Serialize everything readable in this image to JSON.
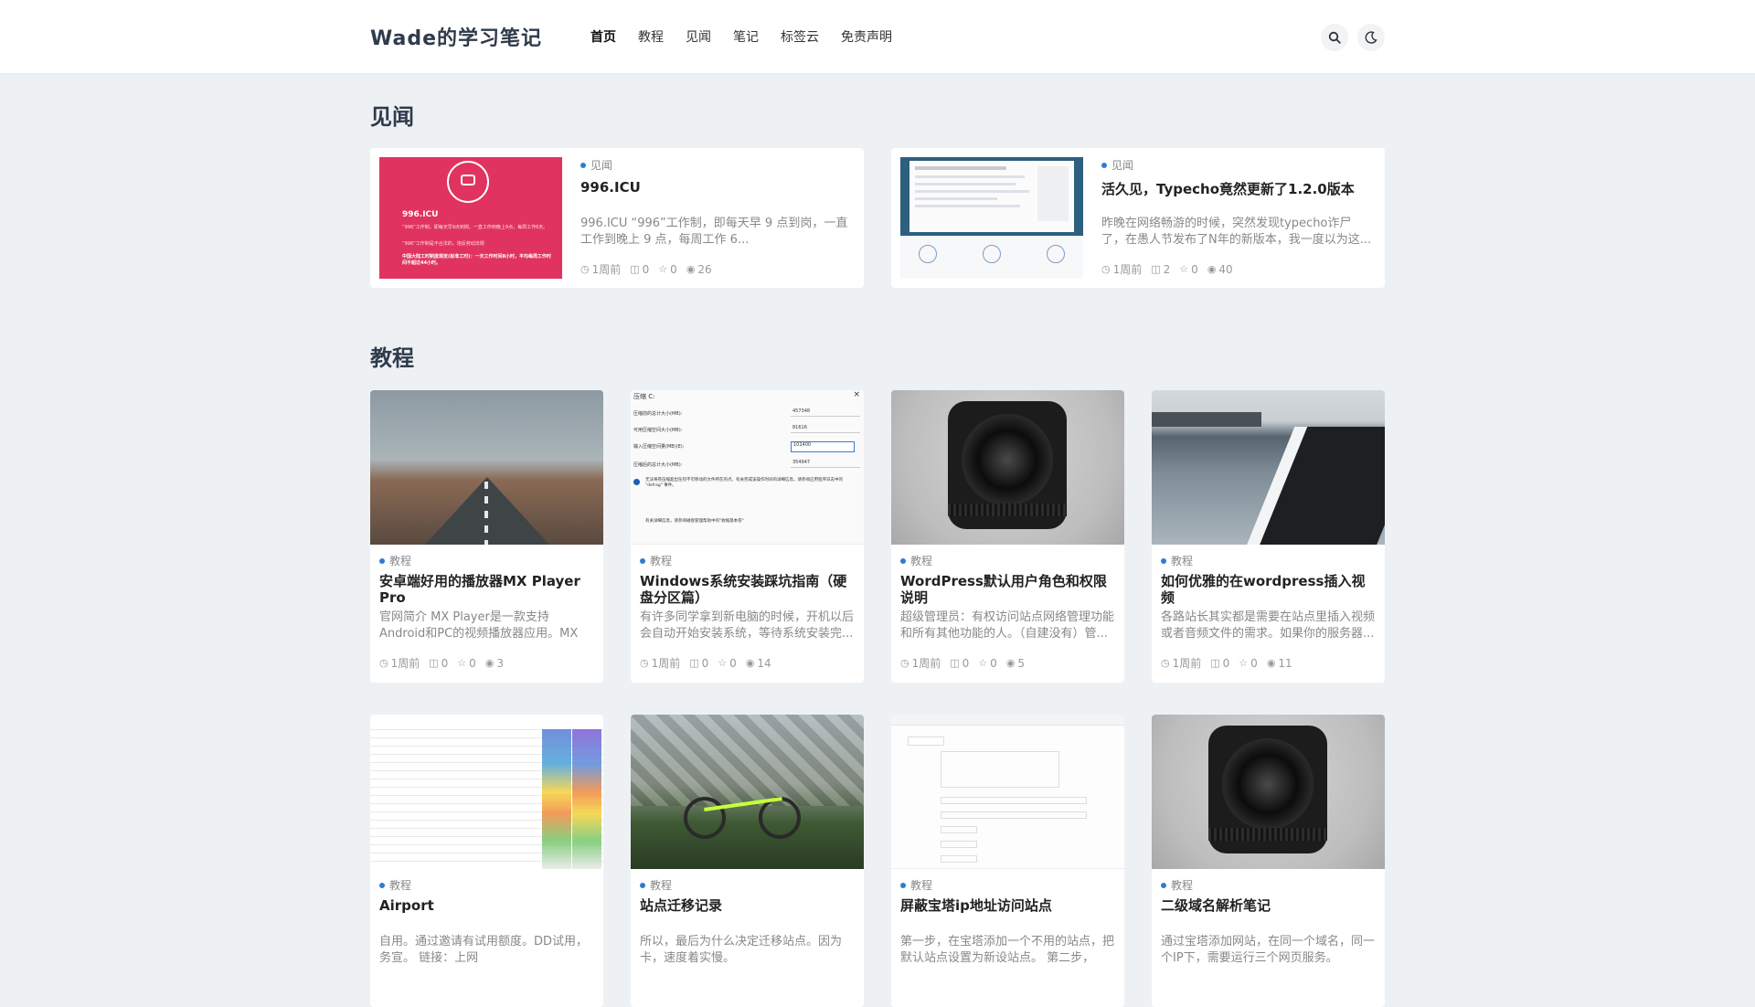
{
  "site": {
    "brand": "Wade的学习笔记"
  },
  "nav": [
    "首页",
    "教程",
    "见闻",
    "笔记",
    "标签云",
    "免责声明"
  ],
  "tools": {
    "search_icon": "⌕",
    "theme_icon": "☾"
  },
  "sections": {
    "news_title": "见闻",
    "tutorial_title": "教程"
  },
  "news": [
    {
      "category": "见闻",
      "title": "996.ICU",
      "excerpt": "996.ICU “996”工作制，即每天早 9 点到岗，一直工作到晚上 9 点，每周工作 6...",
      "time": "1周前",
      "comments": "0",
      "likes": "0",
      "views": "26",
      "thumb": {
        "heading": "996.ICU",
        "lines": [
          "“996”工作制，即每天早9点到岗，一直工作到晚上9点，每周工作6天。",
          "“996”工作制是不合法的，违反劳动法规",
          "中国大陆工时制度规定(标准工时)：一天工作时间8小时，平均每周工作时间不超过44小时。"
        ]
      }
    },
    {
      "category": "见闻",
      "title": "活久见，Typecho竟然更新了1.2.0版本",
      "excerpt": "昨晚在网络畅游的时候，突然发现typecho诈尸了，在愚人节发布了N年的新版本，我一度以为这...",
      "time": "1周前",
      "comments": "2",
      "likes": "0",
      "views": "40"
    }
  ],
  "tutorials": [
    {
      "category": "教程",
      "title": "安卓端好用的播放器MX Player Pro",
      "excerpt": "官网简介 MX Player是一款支持Android和PC的视频播放器应用。MX Playe...",
      "time": "1周前",
      "comments": "0",
      "likes": "0",
      "views": "3"
    },
    {
      "category": "教程",
      "title": "Windows系统安装踩坑指南（硬盘分区篇）",
      "excerpt": "有许多同学拿到新电脑的时候，开机以后会自动开始安装系统，等待系统安装完...",
      "time": "1周前",
      "comments": "0",
      "likes": "0",
      "views": "14",
      "thumb": {
        "header": "压缩 C:",
        "rows": [
          [
            "压缩前的总计大小(MB):",
            "457348"
          ],
          [
            "可用压缩空间大小(MB):",
            "81616"
          ],
          [
            "输入压缩空间量(MB)(E):",
            "102400"
          ],
          [
            "压缩后的总计大小(MB):",
            "354947"
          ]
        ],
        "note": "无法将卷压缩超出任何不可移动的文件所在的点。有关完成该操作时间的详细信息，请参阅应用程序日志中的 \"defrag\" 事件。",
        "note2": "有关详细信息，请参阅磁盘管理帮助中的\"收缩基本卷\""
      }
    },
    {
      "category": "教程",
      "title": "WordPress默认用户角色和权限说明",
      "excerpt": "超级管理员：有权访问站点网络管理功能和所有其他功能的人。（自建没有）管...",
      "time": "1周前",
      "comments": "0",
      "likes": "0",
      "views": "5"
    },
    {
      "category": "教程",
      "title": "如何优雅的在wordpress插入视频",
      "excerpt": "各路站长其实都是需要在站点里插入视频或者音频文件的需求。如果你的服务器...",
      "time": "1周前",
      "comments": "0",
      "likes": "0",
      "views": "11"
    },
    {
      "category": "教程",
      "title": "Airport",
      "excerpt": "自用。通过邀请有试用额度。DD试用，务宣。 链接：上网",
      "time": "",
      "comments": "",
      "likes": "",
      "views": ""
    },
    {
      "category": "教程",
      "title": "站点迁移记录",
      "excerpt": "所以，最后为什么决定迁移站点。因为卡，速度着实慢。",
      "time": "",
      "comments": "",
      "likes": "",
      "views": ""
    },
    {
      "category": "教程",
      "title": "屏蔽宝塔ip地址访问站点",
      "excerpt": "第一步，在宝塔添加一个不用的站点，把默认站点设置为新设站点。 第二步，进...",
      "time": "",
      "comments": "",
      "likes": "",
      "views": ""
    },
    {
      "category": "教程",
      "title": "二级域名解析笔记",
      "excerpt": "通过宝塔添加网站，在同一个域名，同一个IP下，需要运行三个网页服务。",
      "time": "",
      "comments": "",
      "likes": "",
      "views": ""
    }
  ],
  "colors": {
    "accent": "#2f7bd1",
    "icu_red": "#e0335f",
    "bg": "#eef1f4"
  }
}
